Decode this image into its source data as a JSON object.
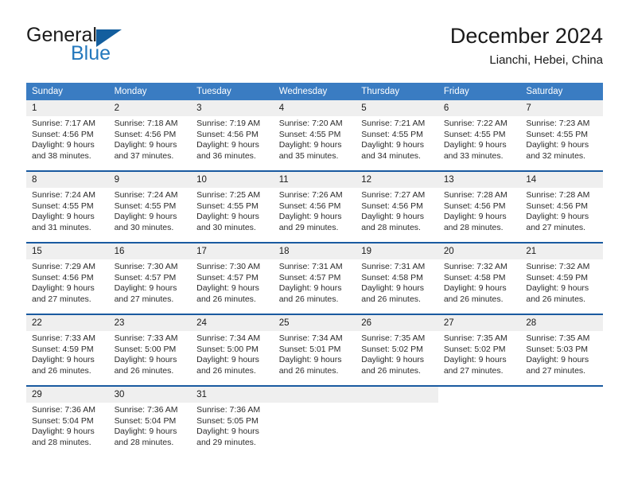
{
  "brand": {
    "name_part1": "General",
    "name_part2": "Blue",
    "triangle_icon": "triangle-icon"
  },
  "header": {
    "title": "December 2024",
    "subtitle": "Lianchi, Hebei, China"
  },
  "colors": {
    "header_blue": "#3a7cc2",
    "row_divider_blue": "#1a5aa0",
    "brand_blue": "#2478bd",
    "daynum_band": "#efefef"
  },
  "calendar": {
    "weekday_headers": [
      "Sunday",
      "Monday",
      "Tuesday",
      "Wednesday",
      "Thursday",
      "Friday",
      "Saturday"
    ],
    "weeks": [
      [
        {
          "day": "1",
          "sunrise": "Sunrise: 7:17 AM",
          "sunset": "Sunset: 4:56 PM",
          "daylight": "Daylight: 9 hours and 38 minutes."
        },
        {
          "day": "2",
          "sunrise": "Sunrise: 7:18 AM",
          "sunset": "Sunset: 4:56 PM",
          "daylight": "Daylight: 9 hours and 37 minutes."
        },
        {
          "day": "3",
          "sunrise": "Sunrise: 7:19 AM",
          "sunset": "Sunset: 4:56 PM",
          "daylight": "Daylight: 9 hours and 36 minutes."
        },
        {
          "day": "4",
          "sunrise": "Sunrise: 7:20 AM",
          "sunset": "Sunset: 4:55 PM",
          "daylight": "Daylight: 9 hours and 35 minutes."
        },
        {
          "day": "5",
          "sunrise": "Sunrise: 7:21 AM",
          "sunset": "Sunset: 4:55 PM",
          "daylight": "Daylight: 9 hours and 34 minutes."
        },
        {
          "day": "6",
          "sunrise": "Sunrise: 7:22 AM",
          "sunset": "Sunset: 4:55 PM",
          "daylight": "Daylight: 9 hours and 33 minutes."
        },
        {
          "day": "7",
          "sunrise": "Sunrise: 7:23 AM",
          "sunset": "Sunset: 4:55 PM",
          "daylight": "Daylight: 9 hours and 32 minutes."
        }
      ],
      [
        {
          "day": "8",
          "sunrise": "Sunrise: 7:24 AM",
          "sunset": "Sunset: 4:55 PM",
          "daylight": "Daylight: 9 hours and 31 minutes."
        },
        {
          "day": "9",
          "sunrise": "Sunrise: 7:24 AM",
          "sunset": "Sunset: 4:55 PM",
          "daylight": "Daylight: 9 hours and 30 minutes."
        },
        {
          "day": "10",
          "sunrise": "Sunrise: 7:25 AM",
          "sunset": "Sunset: 4:55 PM",
          "daylight": "Daylight: 9 hours and 30 minutes."
        },
        {
          "day": "11",
          "sunrise": "Sunrise: 7:26 AM",
          "sunset": "Sunset: 4:56 PM",
          "daylight": "Daylight: 9 hours and 29 minutes."
        },
        {
          "day": "12",
          "sunrise": "Sunrise: 7:27 AM",
          "sunset": "Sunset: 4:56 PM",
          "daylight": "Daylight: 9 hours and 28 minutes."
        },
        {
          "day": "13",
          "sunrise": "Sunrise: 7:28 AM",
          "sunset": "Sunset: 4:56 PM",
          "daylight": "Daylight: 9 hours and 28 minutes."
        },
        {
          "day": "14",
          "sunrise": "Sunrise: 7:28 AM",
          "sunset": "Sunset: 4:56 PM",
          "daylight": "Daylight: 9 hours and 27 minutes."
        }
      ],
      [
        {
          "day": "15",
          "sunrise": "Sunrise: 7:29 AM",
          "sunset": "Sunset: 4:56 PM",
          "daylight": "Daylight: 9 hours and 27 minutes."
        },
        {
          "day": "16",
          "sunrise": "Sunrise: 7:30 AM",
          "sunset": "Sunset: 4:57 PM",
          "daylight": "Daylight: 9 hours and 27 minutes."
        },
        {
          "day": "17",
          "sunrise": "Sunrise: 7:30 AM",
          "sunset": "Sunset: 4:57 PM",
          "daylight": "Daylight: 9 hours and 26 minutes."
        },
        {
          "day": "18",
          "sunrise": "Sunrise: 7:31 AM",
          "sunset": "Sunset: 4:57 PM",
          "daylight": "Daylight: 9 hours and 26 minutes."
        },
        {
          "day": "19",
          "sunrise": "Sunrise: 7:31 AM",
          "sunset": "Sunset: 4:58 PM",
          "daylight": "Daylight: 9 hours and 26 minutes."
        },
        {
          "day": "20",
          "sunrise": "Sunrise: 7:32 AM",
          "sunset": "Sunset: 4:58 PM",
          "daylight": "Daylight: 9 hours and 26 minutes."
        },
        {
          "day": "21",
          "sunrise": "Sunrise: 7:32 AM",
          "sunset": "Sunset: 4:59 PM",
          "daylight": "Daylight: 9 hours and 26 minutes."
        }
      ],
      [
        {
          "day": "22",
          "sunrise": "Sunrise: 7:33 AM",
          "sunset": "Sunset: 4:59 PM",
          "daylight": "Daylight: 9 hours and 26 minutes."
        },
        {
          "day": "23",
          "sunrise": "Sunrise: 7:33 AM",
          "sunset": "Sunset: 5:00 PM",
          "daylight": "Daylight: 9 hours and 26 minutes."
        },
        {
          "day": "24",
          "sunrise": "Sunrise: 7:34 AM",
          "sunset": "Sunset: 5:00 PM",
          "daylight": "Daylight: 9 hours and 26 minutes."
        },
        {
          "day": "25",
          "sunrise": "Sunrise: 7:34 AM",
          "sunset": "Sunset: 5:01 PM",
          "daylight": "Daylight: 9 hours and 26 minutes."
        },
        {
          "day": "26",
          "sunrise": "Sunrise: 7:35 AM",
          "sunset": "Sunset: 5:02 PM",
          "daylight": "Daylight: 9 hours and 26 minutes."
        },
        {
          "day": "27",
          "sunrise": "Sunrise: 7:35 AM",
          "sunset": "Sunset: 5:02 PM",
          "daylight": "Daylight: 9 hours and 27 minutes."
        },
        {
          "day": "28",
          "sunrise": "Sunrise: 7:35 AM",
          "sunset": "Sunset: 5:03 PM",
          "daylight": "Daylight: 9 hours and 27 minutes."
        }
      ],
      [
        {
          "day": "29",
          "sunrise": "Sunrise: 7:36 AM",
          "sunset": "Sunset: 5:04 PM",
          "daylight": "Daylight: 9 hours and 28 minutes."
        },
        {
          "day": "30",
          "sunrise": "Sunrise: 7:36 AM",
          "sunset": "Sunset: 5:04 PM",
          "daylight": "Daylight: 9 hours and 28 minutes."
        },
        {
          "day": "31",
          "sunrise": "Sunrise: 7:36 AM",
          "sunset": "Sunset: 5:05 PM",
          "daylight": "Daylight: 9 hours and 29 minutes."
        },
        {
          "day": "",
          "sunrise": "",
          "sunset": "",
          "daylight": "",
          "empty": true
        },
        {
          "day": "",
          "sunrise": "",
          "sunset": "",
          "daylight": "",
          "empty": true
        },
        {
          "day": "",
          "sunrise": "",
          "sunset": "",
          "daylight": "",
          "blank": true
        },
        {
          "day": "",
          "sunrise": "",
          "sunset": "",
          "daylight": "",
          "blank": true
        }
      ]
    ]
  }
}
